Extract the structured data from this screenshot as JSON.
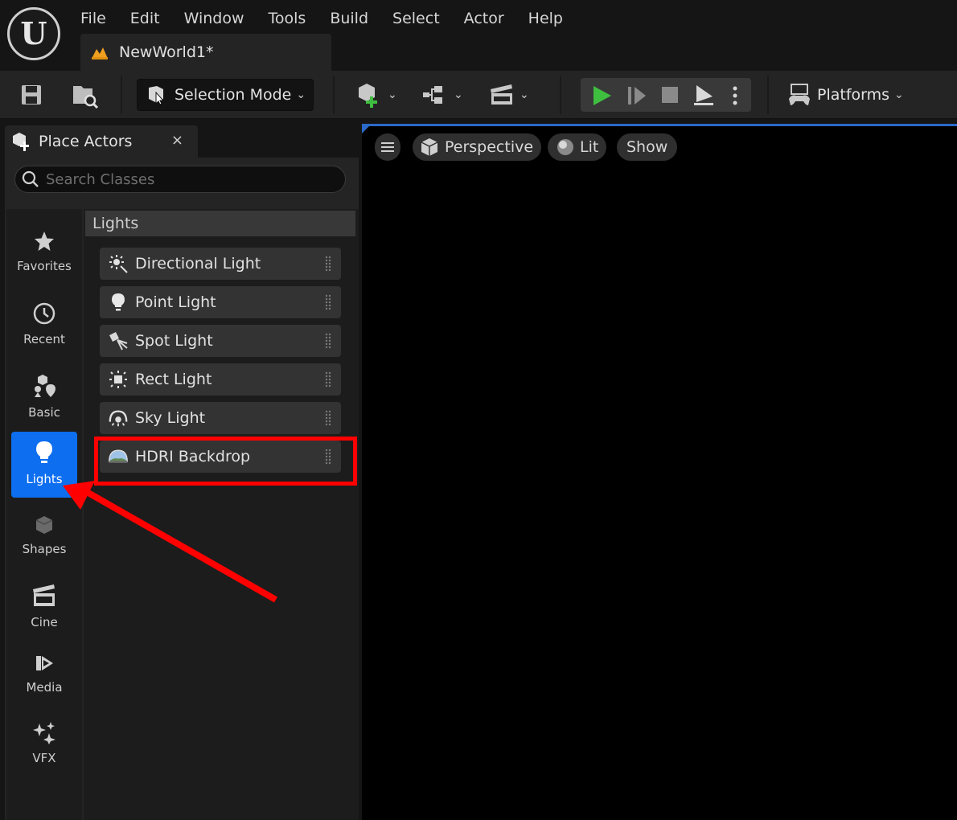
{
  "menu": {
    "items": [
      "File",
      "Edit",
      "Window",
      "Tools",
      "Build",
      "Select",
      "Actor",
      "Help"
    ]
  },
  "level_tab": {
    "label": "NewWorld1*",
    "icon": "level-icon"
  },
  "toolbar": {
    "selection_mode": "Selection Mode",
    "platforms": "Platforms"
  },
  "panel": {
    "title": "Place Actors",
    "close": "×",
    "search_placeholder": "Search Classes",
    "categories": [
      {
        "label": "Favorites",
        "icon": "star-icon"
      },
      {
        "label": "Recent",
        "icon": "clock-icon"
      },
      {
        "label": "Basic",
        "icon": "basic-shapes-icon"
      },
      {
        "label": "Lights",
        "icon": "lightbulb-icon"
      },
      {
        "label": "Shapes",
        "icon": "cube-icon"
      },
      {
        "label": "Cine",
        "icon": "clapperboard-icon"
      },
      {
        "label": "Media",
        "icon": "media-icon"
      },
      {
        "label": "VFX",
        "icon": "sparkles-icon"
      }
    ],
    "active_category": "Lights",
    "list_header": "Lights",
    "actors": [
      {
        "label": "Directional Light",
        "icon": "directional-light-icon"
      },
      {
        "label": "Point Light",
        "icon": "point-light-icon"
      },
      {
        "label": "Spot Light",
        "icon": "spot-light-icon"
      },
      {
        "label": "Rect Light",
        "icon": "rect-light-icon"
      },
      {
        "label": "Sky Light",
        "icon": "sky-light-icon"
      },
      {
        "label": "HDRI Backdrop",
        "icon": "hdri-backdrop-icon"
      }
    ]
  },
  "viewport": {
    "perspective": "Perspective",
    "lit": "Lit",
    "show": "Show"
  },
  "colors": {
    "accent": "#0d6ef0",
    "annotation": "#ff0000",
    "play": "#3fbf3f"
  }
}
